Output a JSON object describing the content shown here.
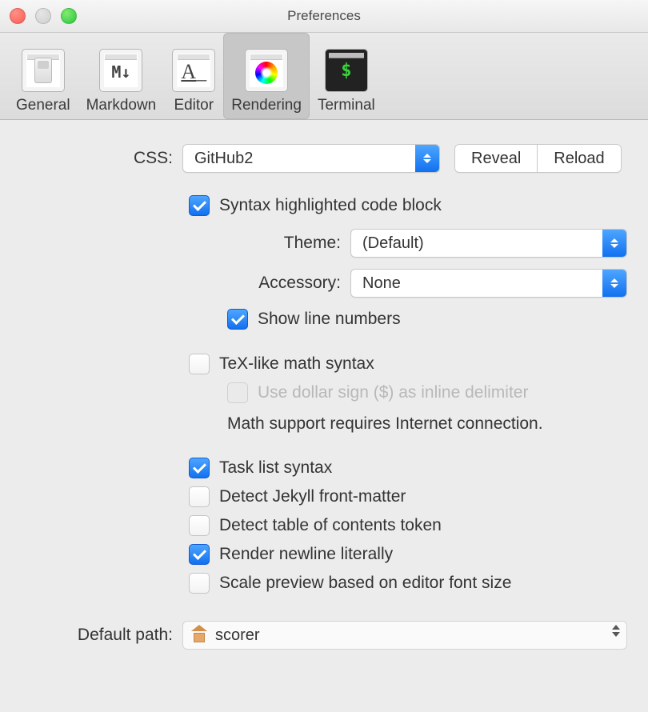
{
  "window": {
    "title": "Preferences"
  },
  "toolbar": {
    "items": [
      {
        "label": "General",
        "selected": false
      },
      {
        "label": "Markdown",
        "selected": false
      },
      {
        "label": "Editor",
        "selected": false
      },
      {
        "label": "Rendering",
        "selected": true
      },
      {
        "label": "Terminal",
        "selected": false
      }
    ]
  },
  "css": {
    "label": "CSS:",
    "value": "GitHub2",
    "reveal_label": "Reveal",
    "reload_label": "Reload"
  },
  "syntax_block": {
    "syntax_highlight": {
      "checked": true,
      "label": "Syntax highlighted code block"
    },
    "theme_label": "Theme:",
    "theme_value": "(Default)",
    "accessory_label": "Accessory:",
    "accessory_value": "None",
    "show_line_numbers": {
      "checked": true,
      "label": "Show line numbers"
    }
  },
  "math_block": {
    "tex_math": {
      "checked": false,
      "label": "TeX-like math syntax"
    },
    "dollar_inline": {
      "checked": false,
      "label": "Use dollar sign ($) as inline delimiter",
      "disabled": true
    },
    "note": "Math support requires Internet connection."
  },
  "misc": {
    "task_list": {
      "checked": true,
      "label": "Task list syntax"
    },
    "jekyll": {
      "checked": false,
      "label": "Detect Jekyll front-matter"
    },
    "toc": {
      "checked": false,
      "label": "Detect table of contents token"
    },
    "newline_literal": {
      "checked": true,
      "label": "Render newline literally"
    },
    "scale_preview": {
      "checked": false,
      "label": "Scale preview based on editor font size"
    }
  },
  "default_path": {
    "label": "Default path:",
    "value": "scorer"
  }
}
